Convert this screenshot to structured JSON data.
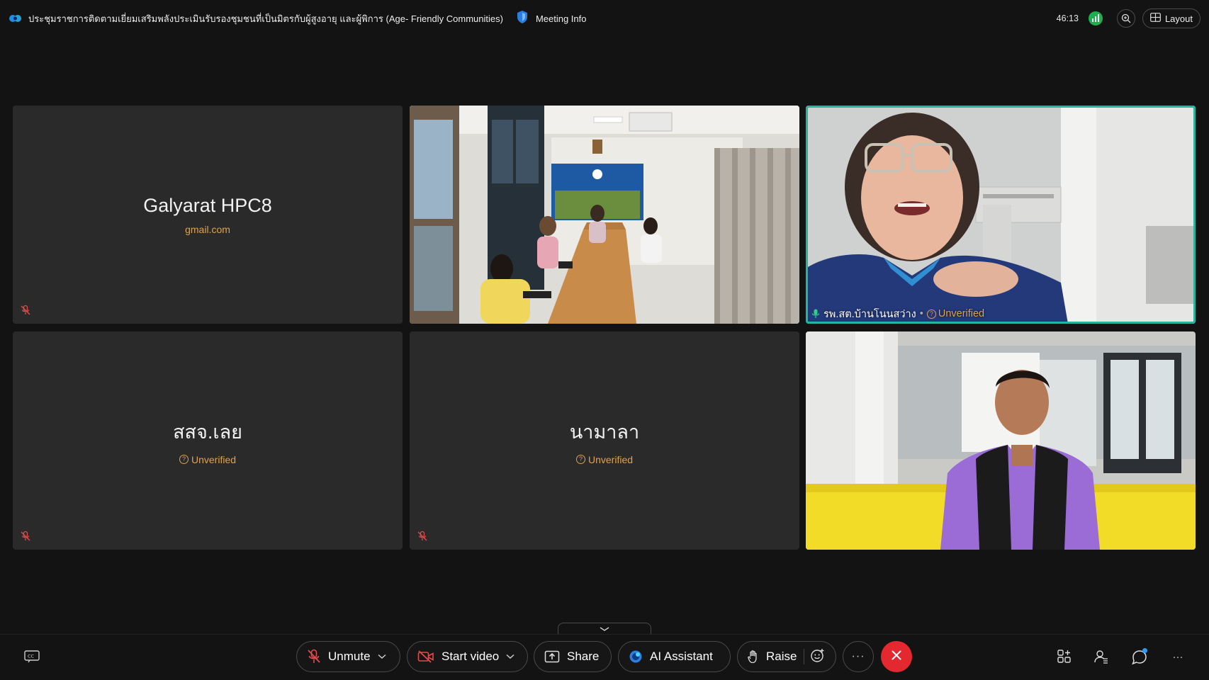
{
  "meeting": {
    "title": "ประชุมราชการติดตามเยี่ยมเสริมพลังประเมินรับรองชุมชนที่เป็นมิตรกับผู้สูงอายุ  และผู้พิการ (Age- Friendly Communities)",
    "info_label": "Meeting Info",
    "elapsed": "46:13",
    "layout_label": "Layout"
  },
  "participants": [
    {
      "name": "Galyarat HPC8",
      "subtitle": "gmail.com",
      "video": false,
      "muted": true
    },
    {
      "name": "",
      "video": true,
      "muted": false,
      "scene": "meeting-room"
    },
    {
      "name": "รพ.สต.บ้านโนนสว่าง",
      "badge": "Unverified",
      "video": true,
      "speaking": true,
      "scene": "woman-glasses"
    },
    {
      "name": "สสจ.เลย",
      "subtitle": "Unverified",
      "video": false,
      "muted": true
    },
    {
      "name": "นามาลา",
      "subtitle": "Unverified",
      "video": false,
      "muted": true
    },
    {
      "name": "",
      "video": true,
      "muted": false,
      "scene": "man-purple-shirt"
    }
  ],
  "controls": {
    "unmute": "Unmute",
    "start_video": "Start video",
    "share": "Share",
    "ai_assistant": "AI Assistant",
    "raise": "Raise",
    "more": "···"
  },
  "colors": {
    "background": "#131313",
    "tile": "#2a2a2a",
    "speaking_outline": "#24b5a0",
    "unverified": "#e0a24a",
    "leave": "#e4282f",
    "connection": "#1fae4e"
  },
  "icons": [
    "webex-logo-icon",
    "shield-icon",
    "network-icon",
    "zoom-icon",
    "layout-icon",
    "mic-muted-icon",
    "video-off-icon",
    "share-icon",
    "ai-assistant-icon",
    "hand-icon",
    "emoji-icon",
    "close-icon",
    "captions-icon",
    "apps-icon",
    "participants-icon",
    "chat-icon",
    "more-icon"
  ]
}
